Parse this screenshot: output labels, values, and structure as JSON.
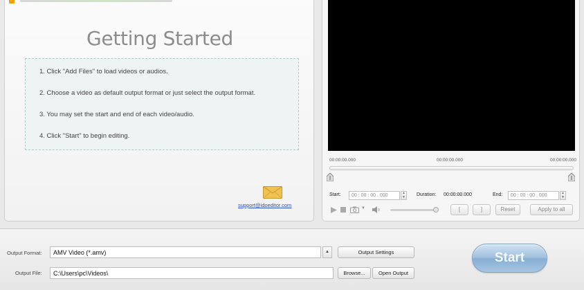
{
  "getting_started": {
    "title": "Getting Started",
    "steps": [
      "1. Click \"Add Files\" to load videos or audios.",
      "2. Choose a video as default output format or just select the output format.",
      "3. You may set the start and end of each video/audio.",
      "4. Click \"Start\" to begin editing."
    ],
    "support_email": "support@idoeditor.com"
  },
  "preview": {
    "timeline_start": "00:00:00.000",
    "timeline_mid": "00:00:00.000",
    "timeline_end": "00:00:00.000",
    "start_label": "Start:",
    "start_value": "00 : 00 : 00 . 000",
    "duration_label": "Duration:",
    "duration_value": "00:00:00.000",
    "end_label": "End:",
    "end_value": "00 : 00 : 00 . 000",
    "mark_in_label": "[",
    "mark_out_label": "]",
    "reset_label": "Reset",
    "apply_all_label": "Apply to all",
    "icons": [
      "play-icon",
      "stop-icon",
      "snapshot-icon",
      "volume-icon"
    ]
  },
  "output": {
    "format_label": "Output Format:",
    "format_value": "AMV Video (*.amv)",
    "settings_label": "Output Settings",
    "file_label": "Output File:",
    "file_value": "C:\\Users\\pc\\Videos\\",
    "browse_label": "Browse...",
    "open_output_label": "Open Output"
  },
  "start_button_label": "Start",
  "colors": {
    "video_bg": "#000000",
    "start_button": "#9fbfdd",
    "link": "#2a4fc4"
  }
}
